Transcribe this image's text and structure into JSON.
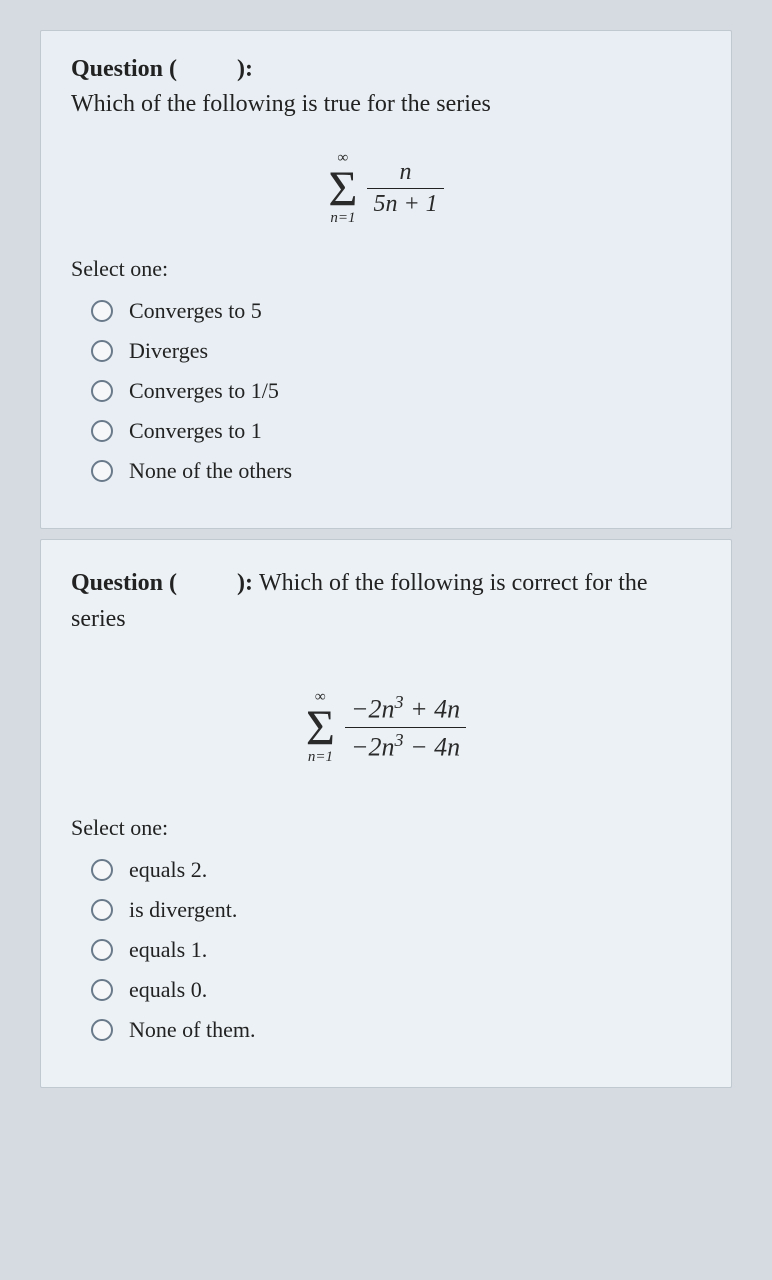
{
  "q1": {
    "header_prefix": "Question (",
    "header_suffix": "):",
    "prompt": "Which of the following is true for the series",
    "formula": {
      "upper": "∞",
      "lower": "n=1",
      "numerator": "n",
      "denominator": "5n + 1"
    },
    "select_label": "Select one:",
    "options": [
      "Converges to 5",
      "Diverges",
      "Converges to 1/5",
      "Converges to 1",
      "None of the others"
    ]
  },
  "q2": {
    "header_prefix": "Question (",
    "header_mid": "): ",
    "prompt": "Which of the following is correct for the series",
    "formula": {
      "upper": "∞",
      "lower": "n=1",
      "numerator_html": "−2n³ + 4n",
      "denominator_html": "−2n³ − 4n"
    },
    "select_label": "Select one:",
    "options": [
      "equals 2.",
      "is divergent.",
      "equals 1.",
      "equals 0.",
      "None of them."
    ]
  }
}
